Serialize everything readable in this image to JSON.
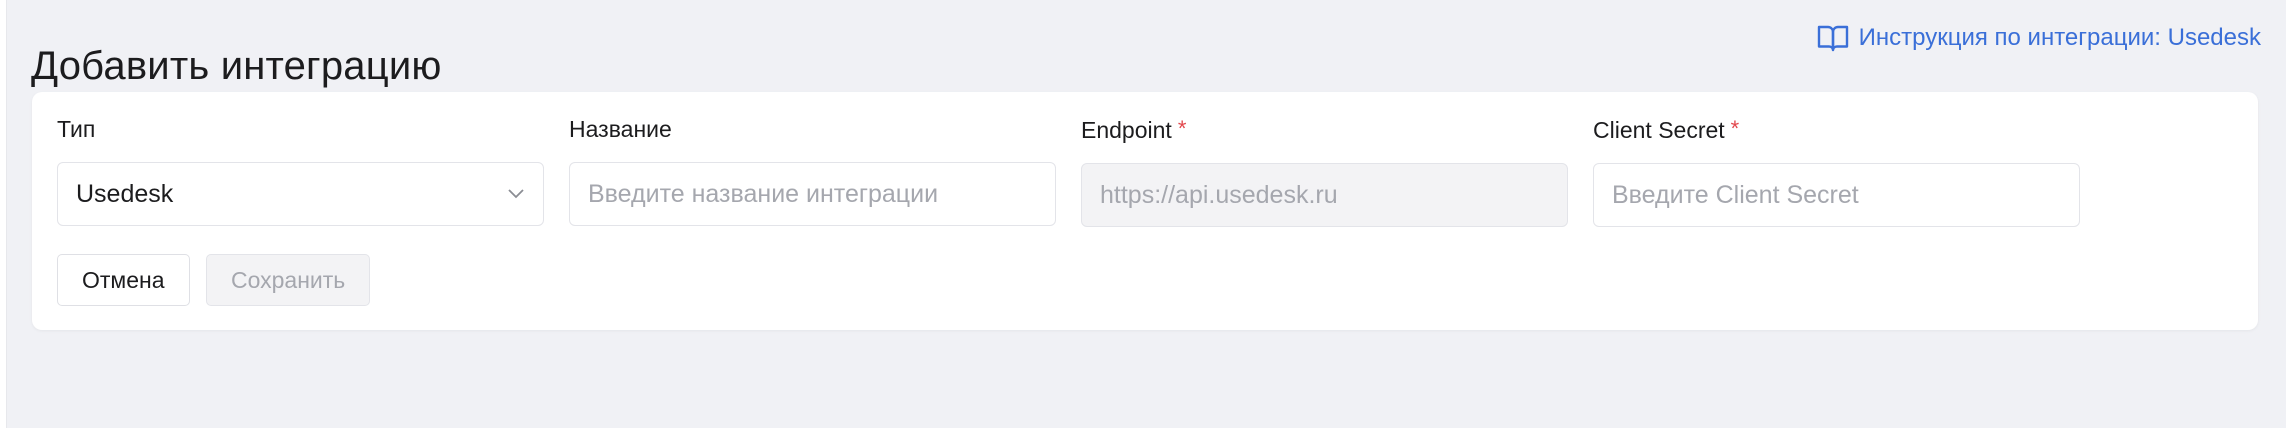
{
  "header": {
    "title": "Добавить интеграцию",
    "help_link": "Инструкция по интеграции: Usedesk",
    "help_icon": "book-icon"
  },
  "form": {
    "type": {
      "label": "Тип",
      "value": "Usedesk",
      "icon": "chevron-down-icon"
    },
    "name": {
      "label": "Название",
      "placeholder": "Введите название интеграции",
      "value": ""
    },
    "endpoint": {
      "label": "Endpoint",
      "required_mark": "*",
      "placeholder": "https://api.usedesk.ru",
      "disabled": true
    },
    "client_secret": {
      "label": "Client Secret",
      "required_mark": "*",
      "placeholder": "Введите Client Secret",
      "value": ""
    }
  },
  "actions": {
    "cancel_label": "Отмена",
    "save_label": "Сохранить",
    "save_disabled": true
  },
  "colors": {
    "background": "#f0f1f5",
    "card": "#ffffff",
    "link": "#3a6fd8",
    "required": "#e2474c",
    "placeholder": "#a5a7ae",
    "disabled_bg": "#f3f3f5"
  }
}
